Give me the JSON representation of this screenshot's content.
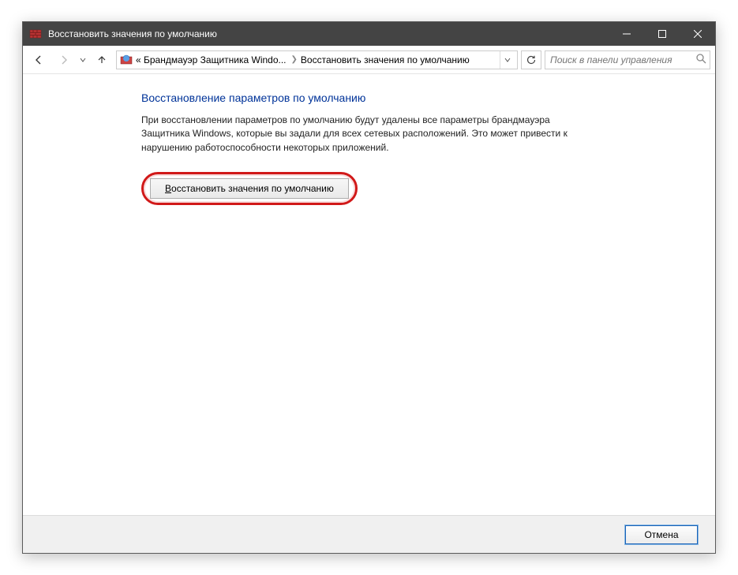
{
  "window": {
    "title": "Восстановить значения по умолчанию"
  },
  "nav": {
    "breadcrumb1": "« Брандмауэр Защитника Windo...",
    "breadcrumb2": "Восстановить значения по умолчанию"
  },
  "search": {
    "placeholder": "Поиск в панели управления"
  },
  "page": {
    "heading": "Восстановление параметров по умолчанию",
    "description": "При восстановлении параметров по умолчанию будут удалены все параметры брандмауэра Защитника Windows, которые вы задали для всех сетевых расположений. Это может привести к нарушению работоспособности некоторых приложений.",
    "restore_button": "Восстановить значения по умолчанию"
  },
  "footer": {
    "cancel": "Отмена"
  }
}
